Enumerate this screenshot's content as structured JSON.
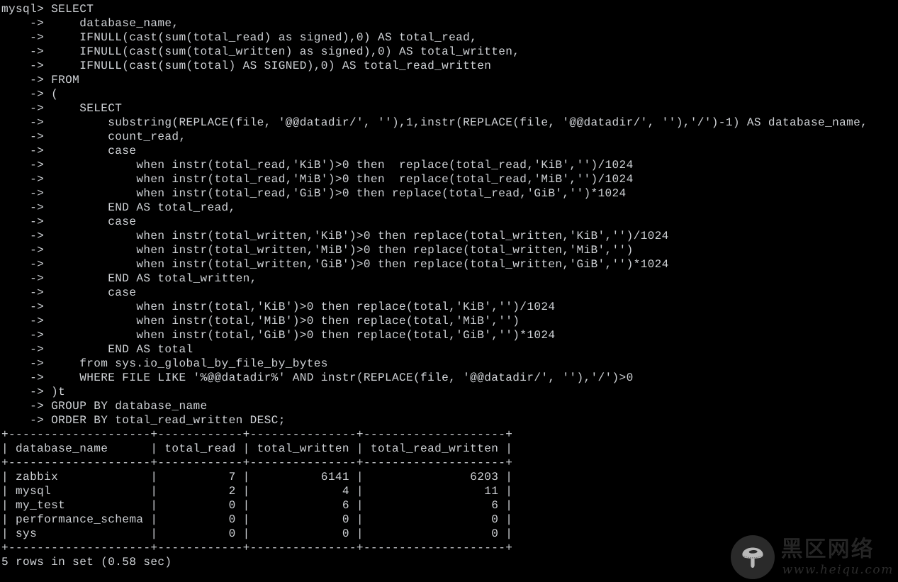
{
  "terminal": {
    "prompt": "mysql>",
    "continuation_prompt": "->",
    "sql_lines": [
      "mysql> SELECT",
      "    ->     database_name,",
      "    ->     IFNULL(cast(sum(total_read) as signed),0) AS total_read,",
      "    ->     IFNULL(cast(sum(total_written) as signed),0) AS total_written,",
      "    ->     IFNULL(cast(sum(total) AS SIGNED),0) AS total_read_written",
      "    -> FROM",
      "    -> (",
      "    ->     SELECT",
      "    ->         substring(REPLACE(file, '@@datadir/', ''),1,instr(REPLACE(file, '@@datadir/', ''),'/')-1) AS database_name,",
      "    ->         count_read,",
      "    ->         case",
      "    ->             when instr(total_read,'KiB')>0 then  replace(total_read,'KiB','')/1024",
      "    ->             when instr(total_read,'MiB')>0 then  replace(total_read,'MiB','')/1024",
      "    ->             when instr(total_read,'GiB')>0 then replace(total_read,'GiB','')*1024",
      "    ->         END AS total_read,",
      "    ->         case",
      "    ->             when instr(total_written,'KiB')>0 then replace(total_written,'KiB','')/1024",
      "    ->             when instr(total_written,'MiB')>0 then replace(total_written,'MiB','')",
      "    ->             when instr(total_written,'GiB')>0 then replace(total_written,'GiB','')*1024",
      "    ->         END AS total_written,",
      "    ->         case",
      "    ->             when instr(total,'KiB')>0 then replace(total,'KiB','')/1024",
      "    ->             when instr(total,'MiB')>0 then replace(total,'MiB','')",
      "    ->             when instr(total,'GiB')>0 then replace(total,'GiB','')*1024",
      "    ->         END AS total",
      "    ->     from sys.io_global_by_file_by_bytes",
      "    ->     WHERE FILE LIKE '%@@datadir%' AND instr(REPLACE(file, '@@datadir/', ''),'/')>0",
      "    -> )t",
      "    -> GROUP BY database_name",
      "    -> ORDER BY total_read_written DESC;"
    ],
    "result_table": {
      "separator": "+--------------------+------------+---------------+--------------------+",
      "header_row": "| database_name      | total_read | total_written | total_read_written |",
      "columns": [
        "database_name",
        "total_read",
        "total_written",
        "total_read_written"
      ],
      "rows": [
        [
          "zabbix",
          "7",
          "6141",
          "6203"
        ],
        [
          "mysql",
          "2",
          "4",
          "11"
        ],
        [
          "my_test",
          "0",
          "6",
          "6"
        ],
        [
          "performance_schema",
          "0",
          "0",
          "0"
        ],
        [
          "sys",
          "0",
          "0",
          "0"
        ]
      ],
      "rendered_rows": [
        "| zabbix             |          7 |          6141 |               6203 |",
        "| mysql              |          2 |             4 |                 11 |",
        "| my_test            |          0 |             6 |                  6 |",
        "| performance_schema |          0 |             0 |                  0 |",
        "| sys                |          0 |             0 |                  0 |"
      ]
    },
    "status_line": "5 rows in set (0.58 sec)",
    "row_count": 5,
    "elapsed": "0.58 sec",
    "colors": {
      "background": "#000000",
      "foreground": "#cfd2d6"
    }
  },
  "watermark": {
    "icon": "mushroom-icon",
    "brand_cn": "黑区网络",
    "url": "www.heiqu.com",
    "badge_color": "#2a2a2a",
    "text_color": "#242424"
  }
}
